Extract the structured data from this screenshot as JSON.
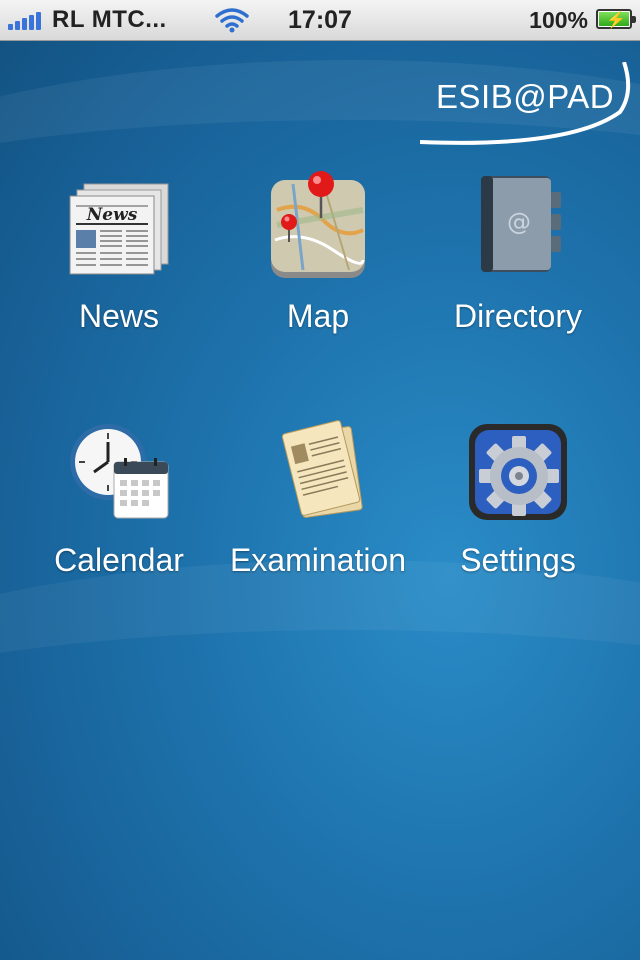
{
  "status_bar": {
    "carrier": "RL  MTC...",
    "time": "17:07",
    "battery": "100%"
  },
  "logo": {
    "text": "ESIB@PAD"
  },
  "apps": [
    {
      "label": "News",
      "icon": "newspaper-icon"
    },
    {
      "label": "Map",
      "icon": "map-icon"
    },
    {
      "label": "Directory",
      "icon": "address-book-icon"
    },
    {
      "label": "Calendar",
      "icon": "calendar-clock-icon"
    },
    {
      "label": "Examination",
      "icon": "document-icon"
    },
    {
      "label": "Settings",
      "icon": "gear-icon"
    }
  ],
  "news_icon": {
    "masthead": "News"
  }
}
